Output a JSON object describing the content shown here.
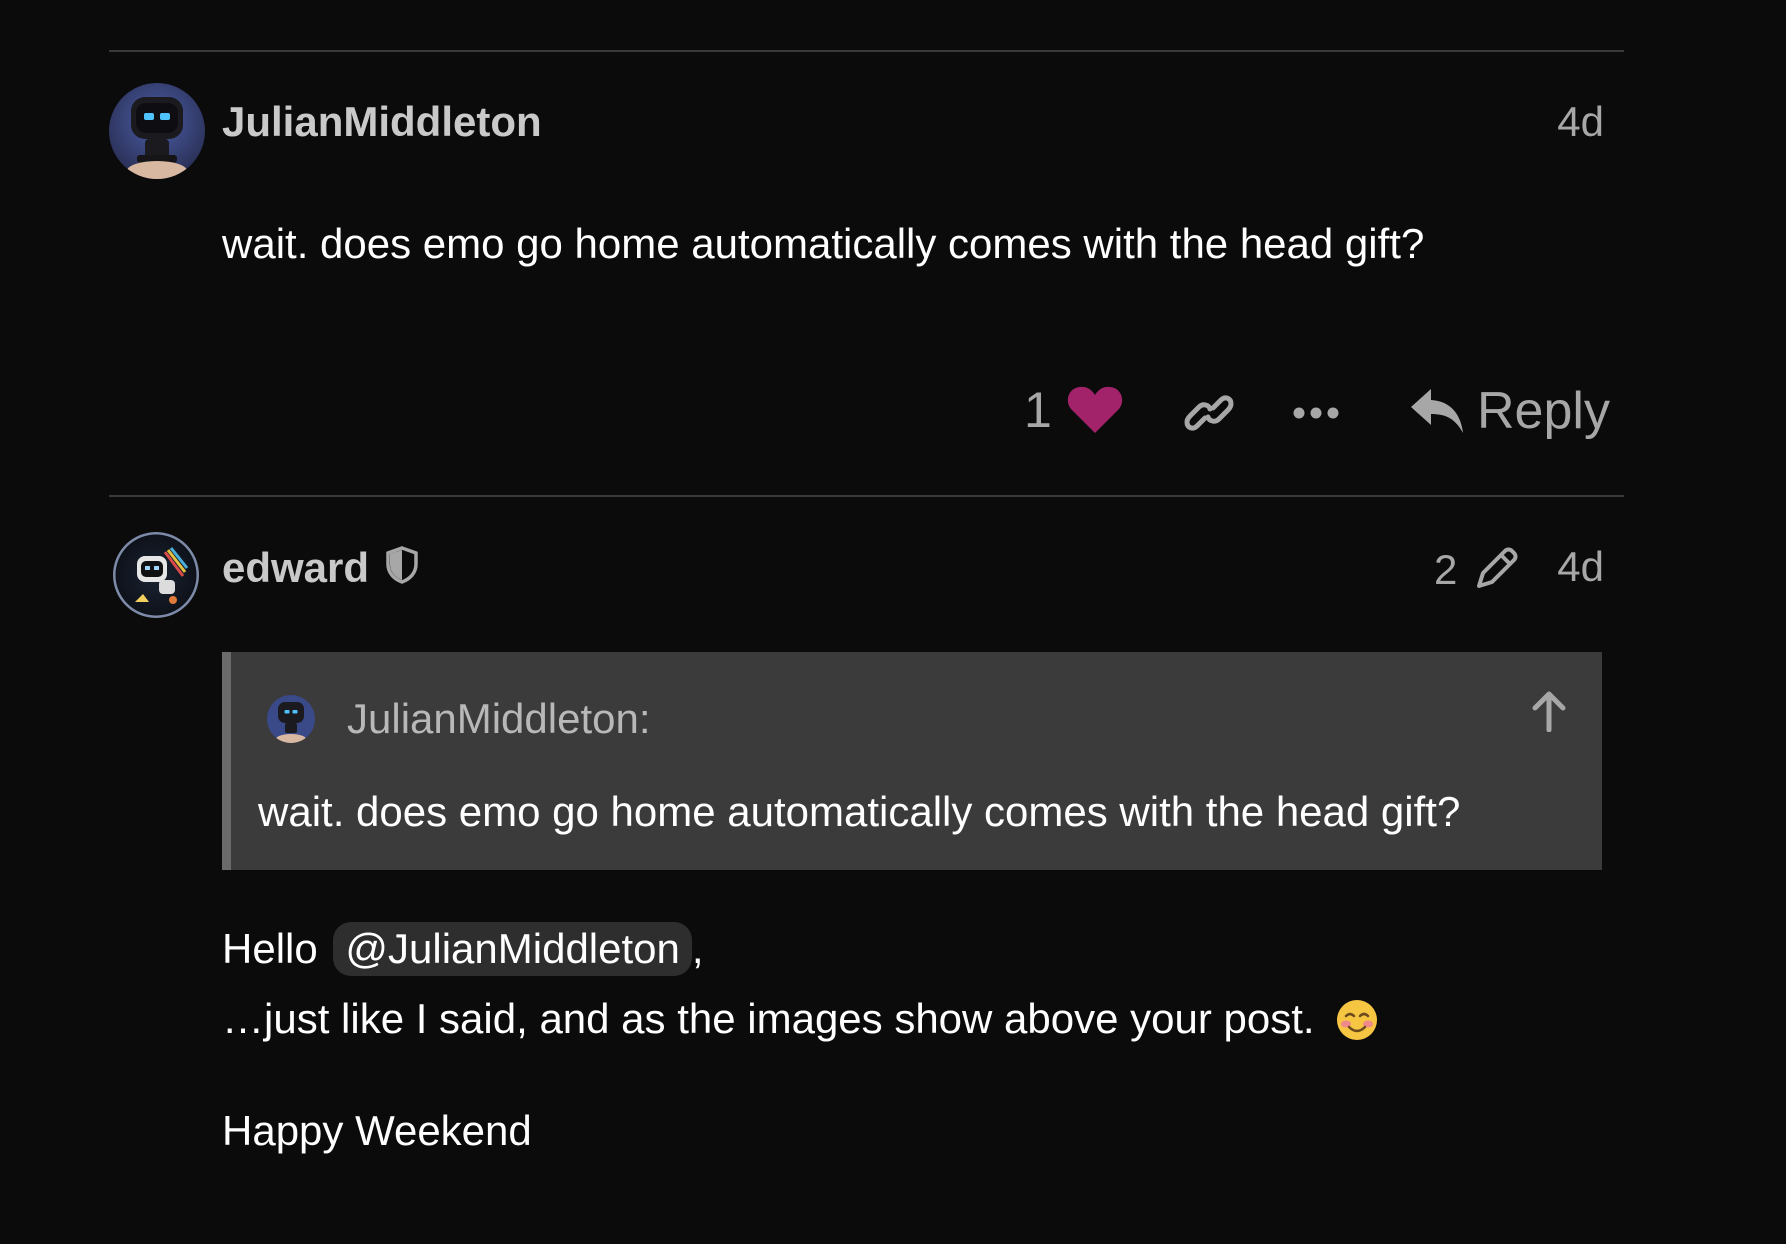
{
  "posts": [
    {
      "username": "JulianMiddleton",
      "date": "4d",
      "body": "wait. does emo go home automatically comes with the head gift?",
      "like_count": "1",
      "reply_label": "Reply"
    },
    {
      "username": "edward",
      "edit_count": "2",
      "date": "4d",
      "quote": {
        "author": "JulianMiddleton:",
        "text": "wait. does emo go home automatically comes with the head gift?"
      },
      "body_hello": "Hello",
      "mention": "@JulianMiddleton",
      "body_comma": ",",
      "body_line2": "…just like I said, and as the images show above your post.",
      "body_line3": "Happy Weekend"
    }
  ],
  "icons": {
    "like": "heart-icon",
    "copy_link": "link-icon",
    "more": "ellipsis-icon",
    "reply": "reply-icon",
    "moderator": "shield-icon",
    "edits": "pencil-icon",
    "jump_up": "arrow-up-icon",
    "emoji": "blush-emoji-icon"
  },
  "colors": {
    "background": "#0b0b0c",
    "like_heart": "#a3236a",
    "quote_bg": "#3b3b3b",
    "muted_text": "#a7a7a7"
  }
}
